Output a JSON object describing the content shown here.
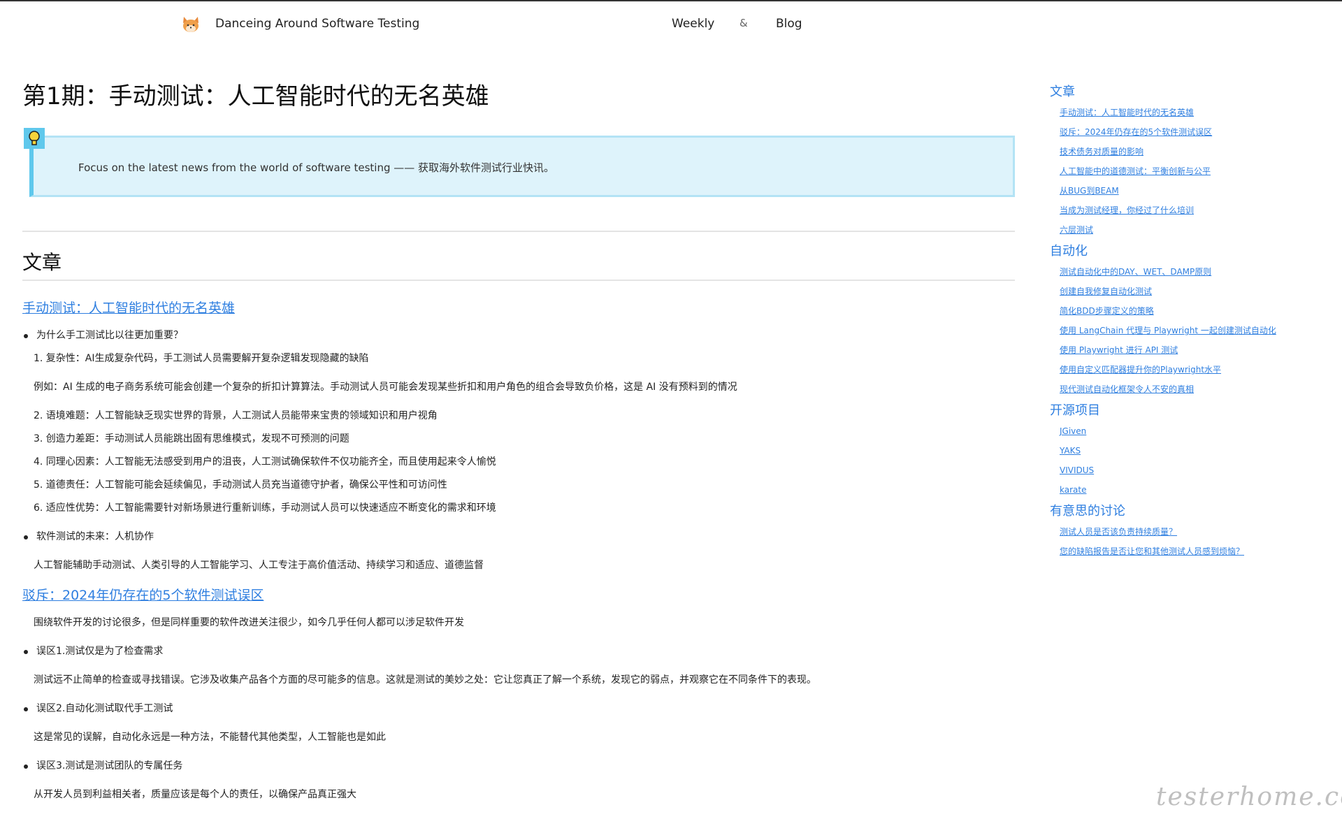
{
  "header": {
    "site_title": "Danceing Around Software Testing",
    "nav": {
      "weekly": "Weekly",
      "separator": "&",
      "blog": "Blog"
    }
  },
  "main": {
    "page_title": "第1期：手动测试：人工智能时代的无名英雄",
    "callout_text": "Focus on the latest news from the world of software testing —— 获取海外软件测试行业快讯。",
    "section_heading": "文章",
    "article1": {
      "title": "手动测试：人工智能时代的无名英雄",
      "bullet1": "为什么手工测试比以往更加重要？",
      "item1": "1. 复杂性：AI生成复杂代码，手工测试人员需要解开复杂逻辑发现隐藏的缺陷",
      "example": "例如：AI 生成的电子商务系统可能会创建一个复杂的折扣计算算法。手动测试人员可能会发现某些折扣和用户角色的组合会导致负价格，这是 AI 没有预料到的情况",
      "item2": "2. 语境难题：人工智能缺乏现实世界的背景，人工测试人员能带来宝贵的领域知识和用户视角",
      "item3": "3. 创造力差距：手动测试人员能跳出固有思维模式，发现不可预测的问题",
      "item4": "4. 同理心因素：人工智能无法感受到用户的沮丧，人工测试确保软件不仅功能齐全，而且使用起来令人愉悦",
      "item5": "5. 道德责任：人工智能可能会延续偏见，手动测试人员充当道德守护者，确保公平性和可访问性",
      "item6": "6. 适应性优势：人工智能需要针对新场景进行重新训练，手动测试人员可以快速适应不断变化的需求和环境",
      "bullet2": "软件测试的未来：人机协作",
      "future": "人工智能辅助手动测试、人类引导的人工智能学习、人工专注于高价值活动、持续学习和适应、道德监督"
    },
    "article2": {
      "title": "驳斥：2024年仍存在的5个软件测试误区",
      "intro": "围绕软件开发的讨论很多，但是同样重要的软件改进关注很少，如今几乎任何人都可以涉足软件开发",
      "myth1": "误区1.测试仅是为了检查需求",
      "myth1_text": "测试远不止简单的检查或寻找错误。它涉及收集产品各个方面的尽可能多的信息。这就是测试的美妙之处：它让您真正了解一个系统，发现它的弱点，并观察它在不同条件下的表现。",
      "myth2": "误区2.自动化测试取代手工测试",
      "myth2_text": "这是常见的误解，自动化永远是一种方法，不能替代其他类型，人工智能也是如此",
      "myth3": "误区3.测试是测试团队的专属任务",
      "myth3_text": "从开发人员到利益相关者，质量应该是每个人的责任，以确保产品真正强大"
    }
  },
  "sidebar": {
    "groups": [
      {
        "title": "文章",
        "links": [
          "手动测试：人工智能时代的无名英雄",
          "驳斥：2024年仍存在的5个软件测试误区",
          "技术债务对质量的影响",
          "人工智能中的道德测试：平衡创新与公平",
          "从BUG到BEAM",
          "当成为测试经理，你经过了什么培训",
          "六层测试"
        ]
      },
      {
        "title": "自动化",
        "links": [
          "测试自动化中的DAY、WET、DAMP原则",
          "创建自我修复自动化测试",
          "简化BDD步骤定义的策略",
          "使用 LangChain 代理与 Playwright 一起创建测试自动化",
          "使用 Playwright 进行 API 测试",
          "使用自定义匹配器提升你的Playwright水平",
          "现代测试自动化框架令人不安的真相"
        ]
      },
      {
        "title": "开源项目",
        "links": [
          "JGiven",
          "YAKS",
          "VIVIDUS",
          "karate"
        ]
      },
      {
        "title": "有意思的讨论",
        "links": [
          "测试人员是否该负责持续质量？",
          "您的缺陷报告是否让您和其他测试人员感到烦恼？"
        ]
      }
    ]
  },
  "watermark": "testerhome.com",
  "colors": {
    "link": "#2f7fe0",
    "callout_bg": "#def3fb",
    "callout_border": "#5fc8ec"
  }
}
